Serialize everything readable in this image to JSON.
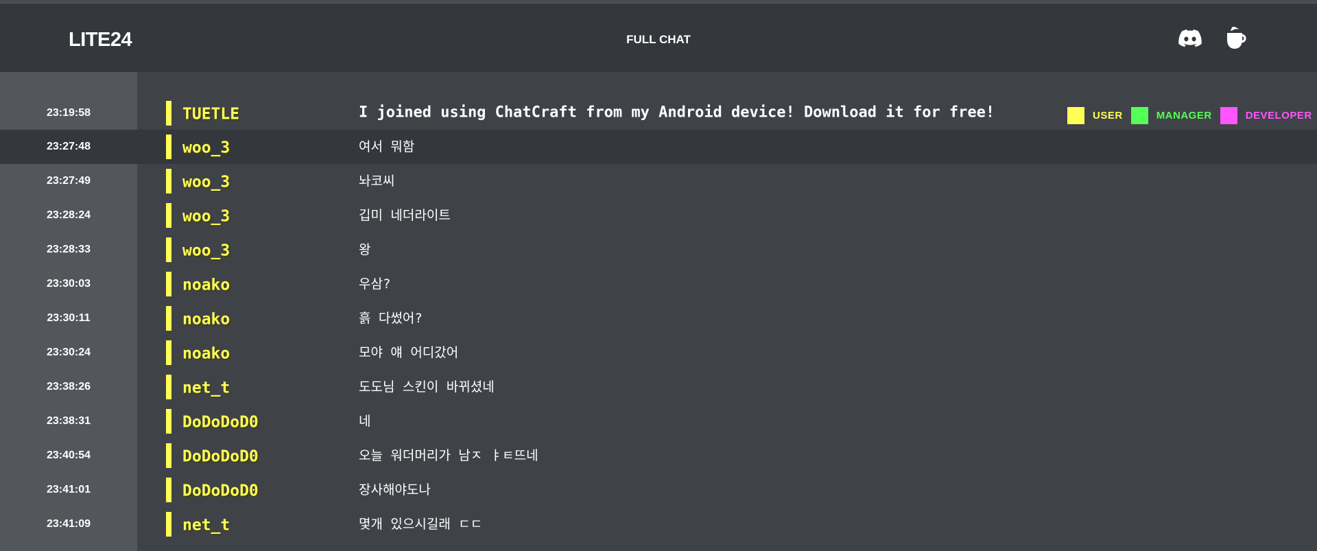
{
  "header": {
    "logo": "LITE24",
    "title": "FULL CHAT",
    "icons": [
      "discord-icon",
      "coffee-icon"
    ]
  },
  "legend": [
    {
      "label": "USER",
      "color": "#ffff55"
    },
    {
      "label": "MANAGER",
      "color": "#55ff55"
    },
    {
      "label": "DEVELOPER",
      "color": "#ff55ff"
    }
  ],
  "colors": {
    "user": "#ffff55",
    "manager": "#55ff55",
    "developer": "#ff55ff"
  },
  "messages": [
    {
      "time": "23:19:58",
      "user": "TUETLE",
      "text": "I joined using ChatCraft from my Android device! Download it for free!"
    },
    {
      "time": "23:27:48",
      "user": "woo_3",
      "text": "여서 뭐함"
    },
    {
      "time": "23:27:49",
      "user": "woo_3",
      "text": "놔코씨"
    },
    {
      "time": "23:28:24",
      "user": "woo_3",
      "text": "깁미 네더라이트"
    },
    {
      "time": "23:28:33",
      "user": "woo_3",
      "text": "왕"
    },
    {
      "time": "23:30:03",
      "user": "noako",
      "text": "우삼?"
    },
    {
      "time": "23:30:11",
      "user": "noako",
      "text": "흙 다썼어?"
    },
    {
      "time": "23:30:24",
      "user": "noako",
      "text": "모야 얘 어디갔어"
    },
    {
      "time": "23:38:26",
      "user": "net_t",
      "text": "도도님 스킨이 바뀌셨네"
    },
    {
      "time": "23:38:31",
      "user": "DoDoDoD0",
      "text": "네"
    },
    {
      "time": "23:40:54",
      "user": "DoDoDoD0",
      "text": "오늘 워더머리가 남ㅈ ㅑㅌ뜨네"
    },
    {
      "time": "23:41:01",
      "user": "DoDoDoD0",
      "text": "장사해야도나"
    },
    {
      "time": "23:41:09",
      "user": "net_t",
      "text": "몇개 있으시길래 ㄷㄷ"
    }
  ]
}
